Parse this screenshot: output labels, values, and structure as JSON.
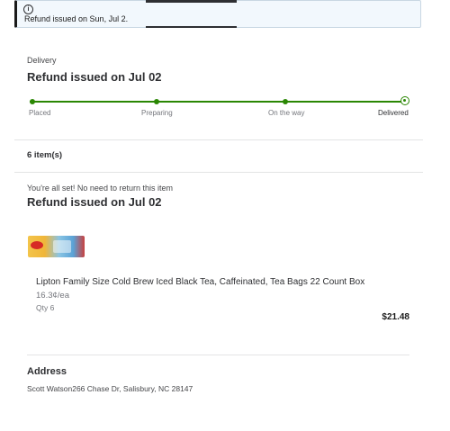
{
  "alert": {
    "text": "Refund issued on Sun, Jul 2.",
    "icon": "info-icon"
  },
  "order": {
    "section_label": "Delivery",
    "status_title": "Refund issued on Jul 02",
    "steps": [
      "Placed",
      "Preparing",
      "On the way",
      "Delivered"
    ],
    "progress_fraction": 1.0,
    "accent_color": "#2a8703"
  },
  "items": {
    "count_label": "6 item(s)",
    "return_note": "You're all set! No need to return this item",
    "refund_title": "Refund issued on Jul 02",
    "product": {
      "name": "Lipton Family Size Cold Brew Iced Black Tea, Caffeinated, Tea Bags 22 Count Box",
      "unit_price": "16.3¢/ea",
      "qty": "Qty 6",
      "price": "$21.48"
    }
  },
  "address": {
    "title": "Address",
    "text": "Scott Watson266 Chase Dr, Salisbury, NC 28147"
  }
}
